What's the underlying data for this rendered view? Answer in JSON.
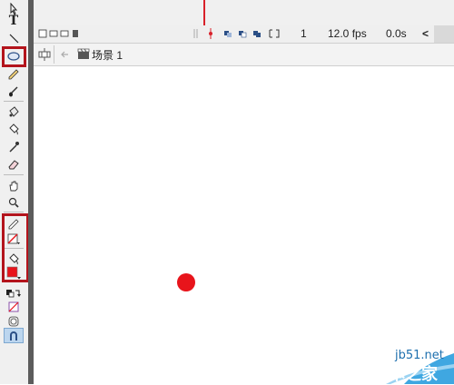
{
  "timeline": {
    "frame_number": "1",
    "fps": "12.0 fps",
    "time": "0.0s",
    "scroll_left": "<"
  },
  "edit_bar": {
    "scene_label": "场景 1"
  },
  "tools": {
    "text_tool_glyph": "T"
  },
  "stage": {
    "circle_color": "#e8141b",
    "background": "#ffffff"
  },
  "highlight_color": "#b3141c",
  "watermark": {
    "site": "jb51.net",
    "name": "脚本之家"
  },
  "icons": [
    "subselection-icon",
    "text-icon",
    "line-icon",
    "oval-icon",
    "pencil-icon",
    "brush-icon",
    "ink-bottle-icon",
    "paint-bucket-icon",
    "eyedropper-icon",
    "eraser-icon",
    "hand-icon",
    "zoom-icon",
    "stroke-color-icon",
    "fill-color-icon",
    "swap-colors-icon",
    "no-color-icon",
    "object-drawing-icon",
    "snap-icon"
  ]
}
